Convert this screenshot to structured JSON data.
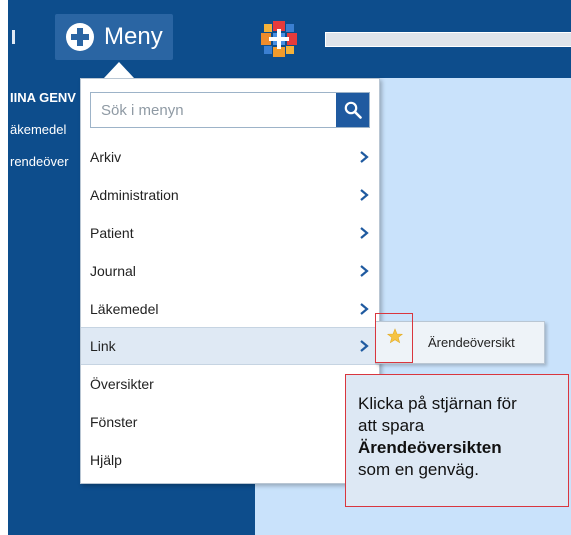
{
  "header": {
    "menu_label": "Meny"
  },
  "left_panel": {
    "items": [
      "IINA GENV",
      "äkemedel",
      "rendeöver"
    ]
  },
  "dropdown": {
    "search_placeholder": "Sök i menyn",
    "items": [
      {
        "label": "Arkiv",
        "has_submenu": true
      },
      {
        "label": "Administration",
        "has_submenu": true
      },
      {
        "label": "Patient",
        "has_submenu": true
      },
      {
        "label": "Journal",
        "has_submenu": true
      },
      {
        "label": "Läkemedel",
        "has_submenu": true
      },
      {
        "label": "Link",
        "has_submenu": true,
        "active": true
      },
      {
        "label": "Översikter",
        "has_submenu": false
      },
      {
        "label": "Fönster",
        "has_submenu": false
      },
      {
        "label": "Hjälp",
        "has_submenu": false
      }
    ]
  },
  "submenu": {
    "item_label": "Ärendeöversikt",
    "icon": "star-icon"
  },
  "callout": {
    "line1": "Klicka på stjärnan för",
    "line2": "att spara",
    "line3_bold": "Ärendeöversikten",
    "line4": "som en genväg."
  },
  "colors": {
    "header_blue": "#0d4d8c",
    "menu_button": "#2a65a3",
    "content_light": "#c9e2fb",
    "highlight_red": "#d9363e",
    "star_yellow": "#f6c343"
  }
}
